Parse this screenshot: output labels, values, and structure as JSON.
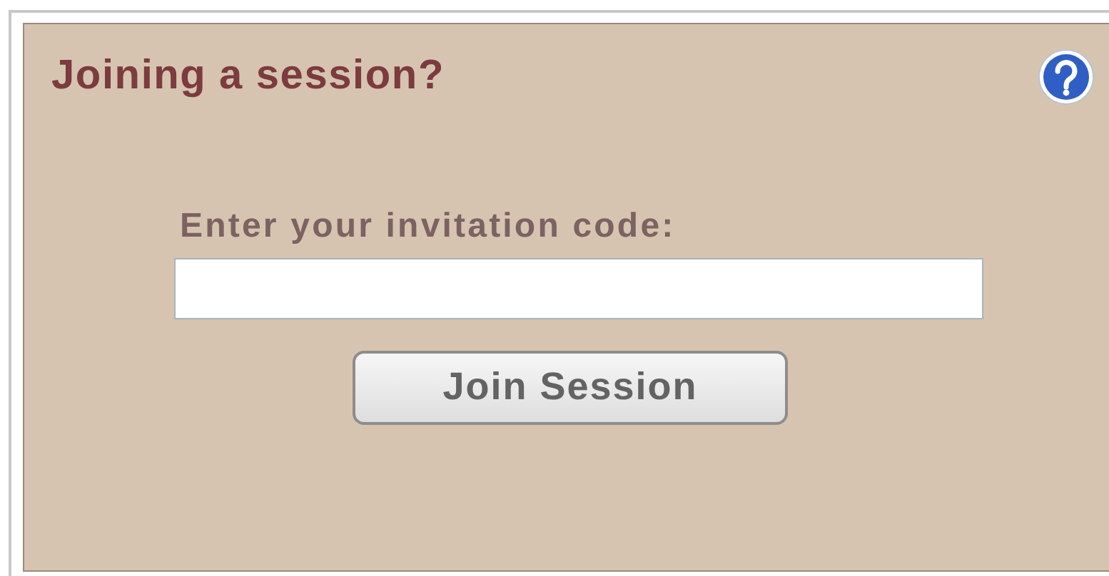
{
  "panel": {
    "title": "Joining a session?"
  },
  "form": {
    "label": "Enter your invitation code:",
    "button": "Join Session"
  }
}
